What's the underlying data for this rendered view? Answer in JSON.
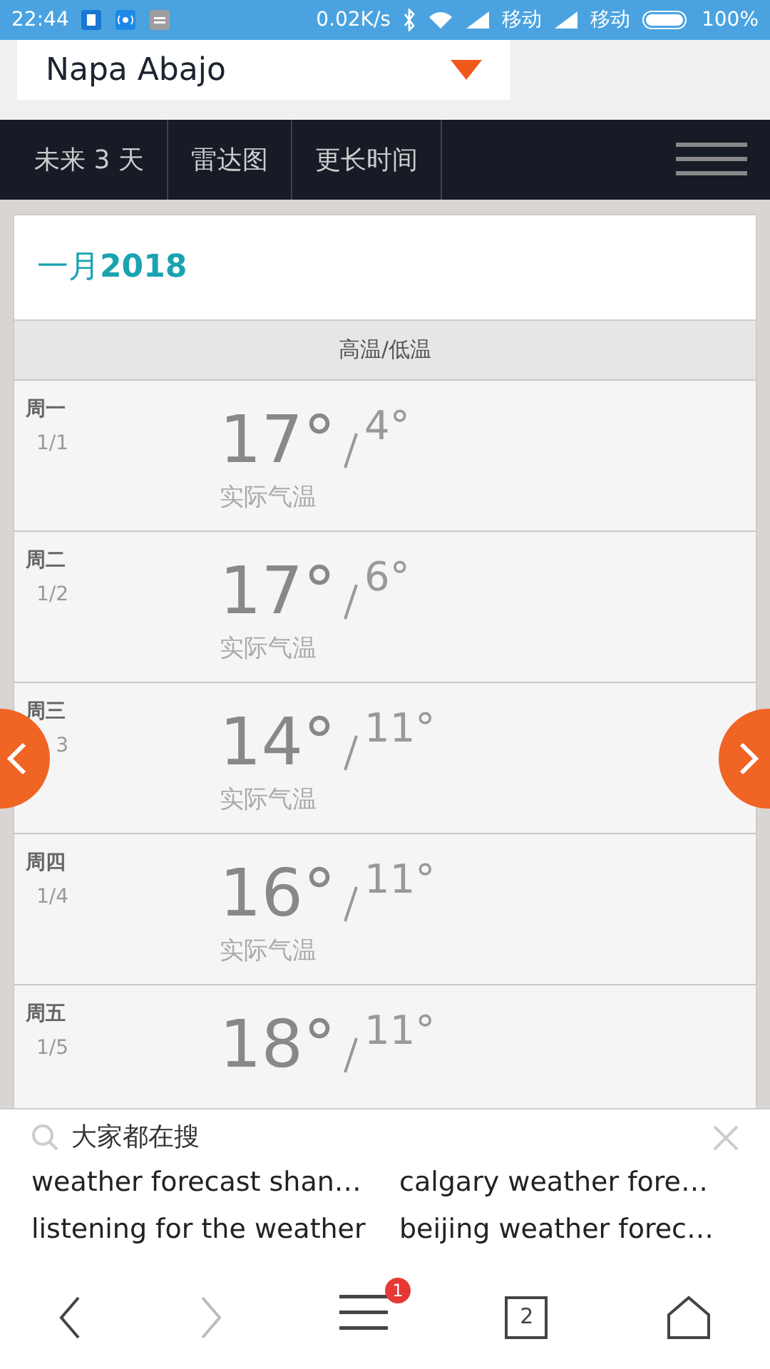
{
  "status_bar": {
    "time": "22:44",
    "speed": "0.02K/s",
    "carriers": [
      "移动",
      "移动"
    ],
    "battery": "100%"
  },
  "location": {
    "value": "Napa Abajo"
  },
  "nav": {
    "tabs": [
      "未来 3 天",
      "雷达图",
      "更长时间"
    ]
  },
  "month": {
    "name": "一月",
    "year": "2018"
  },
  "column_header": "高温/低温",
  "days": [
    {
      "weekday": "周一",
      "date": "1/1",
      "high": "17°",
      "low": "4°",
      "note": "实际气温"
    },
    {
      "weekday": "周二",
      "date": "1/2",
      "high": "17°",
      "low": "6°",
      "note": "实际气温"
    },
    {
      "weekday": "周三",
      "date": "3",
      "high": "14°",
      "low": "11°",
      "note": "实际气温"
    },
    {
      "weekday": "周四",
      "date": "1/4",
      "high": "16°",
      "low": "11°",
      "note": "实际气温"
    },
    {
      "weekday": "周五",
      "date": "1/5",
      "high": "18°",
      "low": "11°"
    }
  ],
  "suggestions": {
    "title": "大家都在搜",
    "items": [
      "weather forecast shan…",
      "calgary weather fore…",
      "listening for the weather",
      "beijing weather forec…"
    ]
  },
  "browser_bar": {
    "forward_disabled": true,
    "menu_badge": "1",
    "tab_count": "2"
  }
}
